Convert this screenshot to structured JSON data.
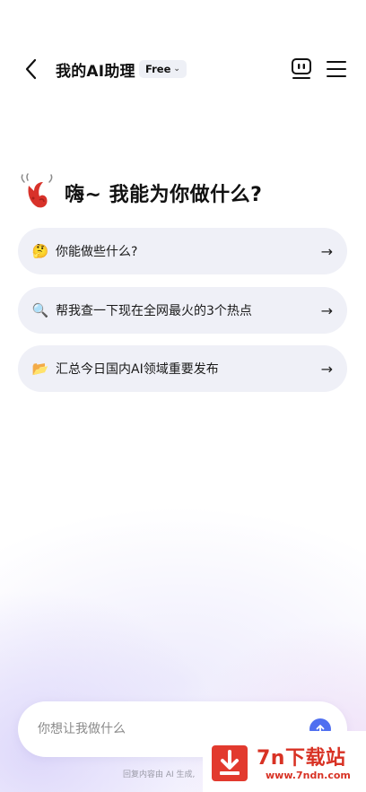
{
  "header": {
    "title": "我的AI助理",
    "badge": "Free"
  },
  "greeting": {
    "text": "嗨~ 我能为你做什么?"
  },
  "suggestions": [
    {
      "emoji": "🤔",
      "label": "你能做些什么?",
      "arrow": "→"
    },
    {
      "emoji": "🔍",
      "label": "帮我查一下现在全网最火的3个热点",
      "arrow": "→"
    },
    {
      "emoji": "📂",
      "label": "汇总今日国内AI领域重要发布",
      "arrow": "→"
    }
  ],
  "composer": {
    "placeholder": "你想让我做什么"
  },
  "footnote": "回复内容由 AI 生成,",
  "watermark": {
    "title": "7n下载站",
    "url": "www.7ndn.com"
  },
  "colors": {
    "card_bg": "#eff0f7",
    "send_button": "#4f6ff0",
    "watermark_red": "#d83224"
  }
}
